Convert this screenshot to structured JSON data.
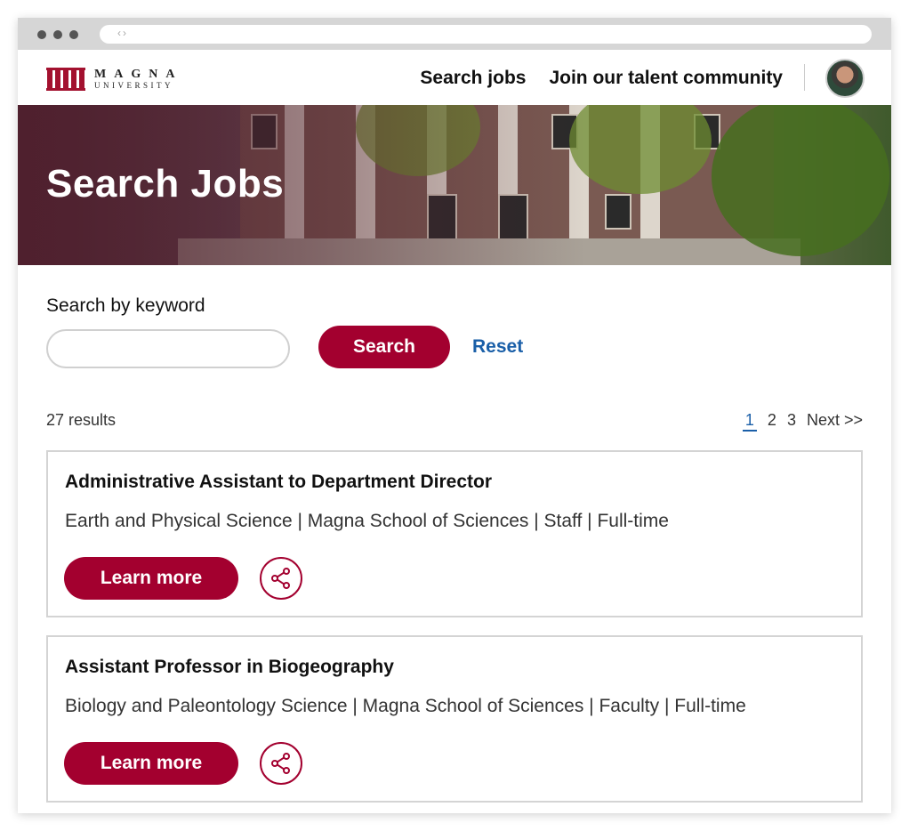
{
  "brand": {
    "line1": "MAGNA",
    "line2": "UNIVERSITY",
    "color": "#a3002f"
  },
  "nav": {
    "links": [
      "Search jobs",
      "Join our talent community"
    ]
  },
  "hero": {
    "title": "Search Jobs"
  },
  "search": {
    "label": "Search by keyword",
    "input_value": "",
    "button_label": "Search",
    "reset_label": "Reset"
  },
  "results": {
    "count_text": "27 results",
    "pages": [
      "1",
      "2",
      "3"
    ],
    "current_page": "1",
    "next_label": "Next >>"
  },
  "jobs": [
    {
      "title": "Administrative Assistant to Department Director",
      "meta": "Earth and Physical Science | Magna School of Sciences | Staff | Full-time",
      "button_label": "Learn more"
    },
    {
      "title": "Assistant Professor in Biogeography",
      "meta": "Biology and Paleontology Science | Magna School of Sciences | Faculty | Full-time",
      "button_label": "Learn more"
    }
  ],
  "icons": {
    "share": "share-icon",
    "avatar": "user-avatar"
  }
}
